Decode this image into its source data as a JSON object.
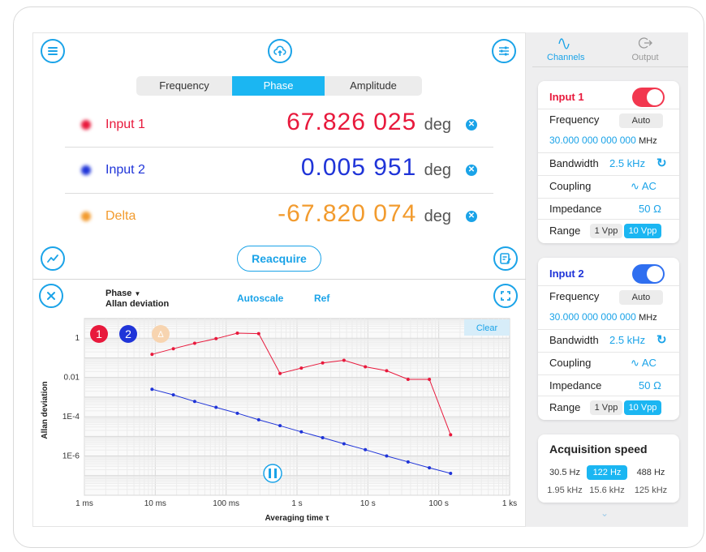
{
  "header": {
    "segments": [
      "Frequency",
      "Phase",
      "Amplitude"
    ],
    "active_segment": "Phase"
  },
  "readings": [
    {
      "name": "Input 1",
      "value": "67.826 025",
      "unit": "deg",
      "color": "#e8193c"
    },
    {
      "name": "Input 2",
      "value": "0.005 951",
      "unit": "deg",
      "color": "#1f34d8"
    },
    {
      "name": "Delta",
      "value": "-67.820 074",
      "unit": "deg",
      "color": "#f29b2e"
    }
  ],
  "reacquire_label": "Reacquire",
  "plot": {
    "selector_line1": "Phase",
    "selector_line2": "Allan deviation",
    "autoscale_label": "Autoscale",
    "ref_label": "Ref",
    "clear_label": "Clear",
    "badges": [
      "1",
      "2",
      "Δ"
    ]
  },
  "chart_data": {
    "type": "line",
    "title": "",
    "xlabel": "Averaging time τ",
    "ylabel": "Allan deviation",
    "x_scale": "log",
    "y_scale": "log",
    "xlim": [
      0.001,
      1000
    ],
    "ylim": [
      1e-08,
      10
    ],
    "x_ticks": [
      {
        "value": 0.001,
        "label": "1 ms"
      },
      {
        "value": 0.01,
        "label": "10 ms"
      },
      {
        "value": 0.1,
        "label": "100 ms"
      },
      {
        "value": 1,
        "label": "1 s"
      },
      {
        "value": 10,
        "label": "10 s"
      },
      {
        "value": 100,
        "label": "100 s"
      },
      {
        "value": 1000,
        "label": "1 ks"
      }
    ],
    "y_ticks": [
      {
        "value": 1,
        "label": "1"
      },
      {
        "value": 0.01,
        "label": "0.01"
      },
      {
        "value": 0.0001,
        "label": "1E-4"
      },
      {
        "value": 1e-06,
        "label": "1E-6"
      }
    ],
    "grid": true,
    "series": [
      {
        "color": "#e8193c",
        "x": [
          0.009,
          0.018,
          0.036,
          0.072,
          0.144,
          0.288,
          0.576,
          1.15,
          2.3,
          4.6,
          9.2,
          18.4,
          36.9,
          73.7,
          147
        ],
        "y": [
          0.15,
          0.29,
          0.55,
          0.95,
          1.8,
          1.7,
          0.016,
          0.03,
          0.055,
          0.075,
          0.035,
          0.022,
          0.008,
          0.008,
          1.2e-05
        ]
      },
      {
        "color": "#1f34d8",
        "x": [
          0.009,
          0.018,
          0.036,
          0.072,
          0.144,
          0.288,
          0.576,
          1.15,
          2.3,
          4.6,
          9.2,
          18.4,
          36.9,
          73.7,
          147
        ],
        "y": [
          0.0025,
          0.0013,
          0.0006,
          0.0003,
          0.00015,
          7e-05,
          3.5e-05,
          1.7e-05,
          8.5e-06,
          4.2e-06,
          2.1e-06,
          1e-06,
          5e-07,
          2.5e-07,
          1.3e-07
        ]
      }
    ]
  },
  "sidebar": {
    "tabs": [
      "Channels",
      "Output"
    ],
    "active_tab": "Channels",
    "input1": {
      "title": "Input 1",
      "frequency_label": "Frequency",
      "auto_label": "Auto",
      "frequency_value": "30.000 000 000 000",
      "frequency_unit": "MHz",
      "bandwidth_label": "Bandwidth",
      "bandwidth_value": "2.5 kHz",
      "coupling_label": "Coupling",
      "coupling_value": "AC",
      "impedance_label": "Impedance",
      "impedance_value": "50 Ω",
      "range_label": "Range",
      "range_options": [
        "1 Vpp",
        "10 Vpp"
      ],
      "range_selected": "10 Vpp",
      "toggle_color": "#f2374f"
    },
    "input2": {
      "title": "Input 2",
      "frequency_label": "Frequency",
      "auto_label": "Auto",
      "frequency_value": "30.000 000 000 000",
      "frequency_unit": "MHz",
      "bandwidth_label": "Bandwidth",
      "bandwidth_value": "2.5 kHz",
      "coupling_label": "Coupling",
      "coupling_value": "AC",
      "impedance_label": "Impedance",
      "impedance_value": "50 Ω",
      "range_label": "Range",
      "range_options": [
        "1 Vpp",
        "10 Vpp"
      ],
      "range_selected": "10 Vpp",
      "toggle_color": "#2f6ff0"
    },
    "acquisition": {
      "title": "Acquisition speed",
      "options": [
        "30.5 Hz",
        "122 Hz",
        "488 Hz",
        "1.95 kHz",
        "15.6 kHz",
        "125 kHz"
      ],
      "selected": "122 Hz"
    }
  }
}
